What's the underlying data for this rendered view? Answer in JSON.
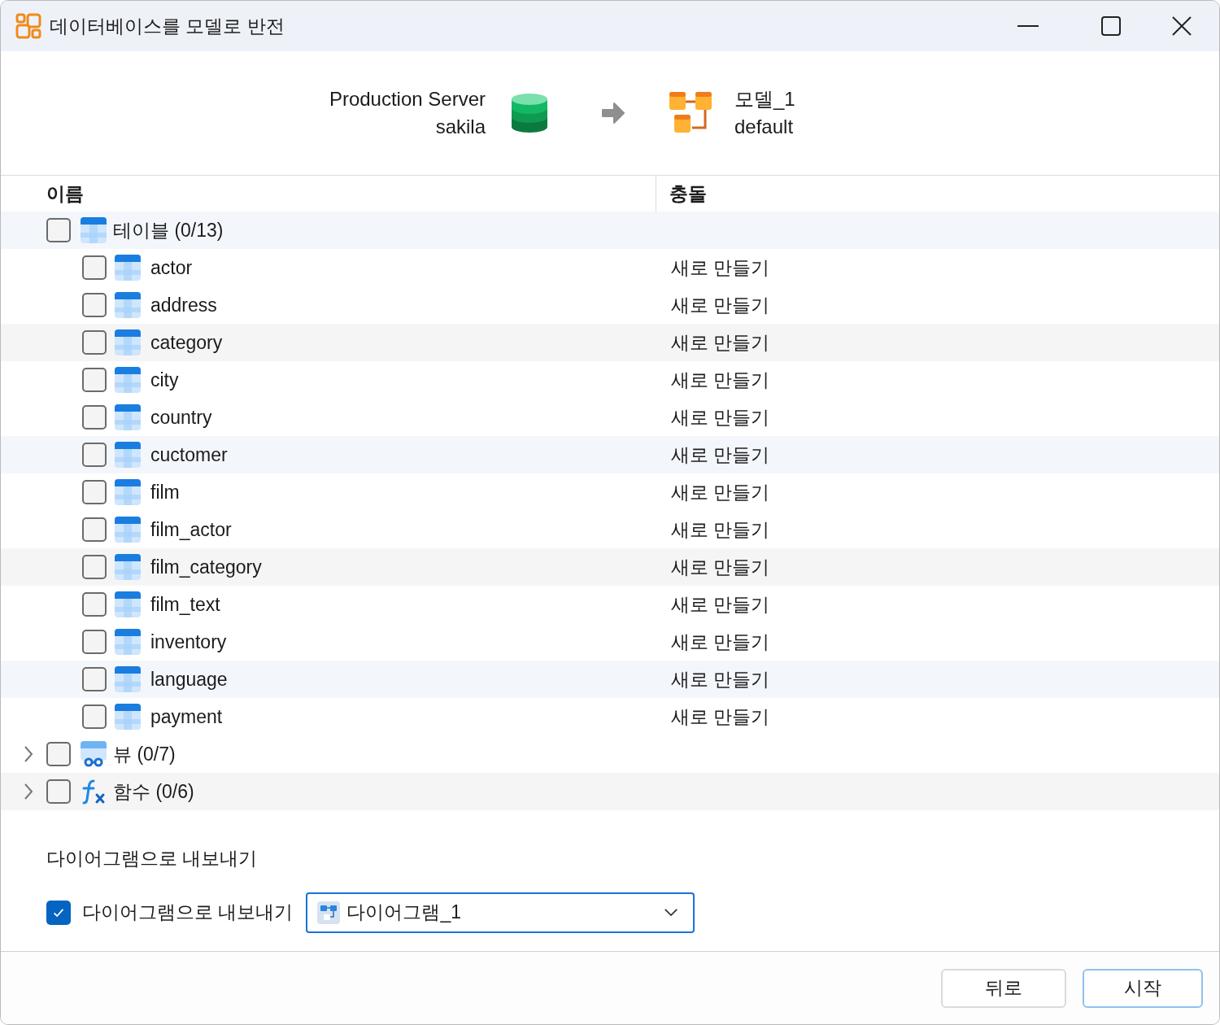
{
  "window": {
    "title": "데이터베이스를 모델로 반전"
  },
  "source": {
    "server": "Production Server",
    "database": "sakila"
  },
  "target": {
    "model": "모델_1",
    "schema": "default"
  },
  "columns": [
    "이름",
    "충돌"
  ],
  "tree": [
    {
      "kind": "table",
      "label": "테이블 (0/13)",
      "checked": false,
      "expanded": true,
      "children": [
        {
          "name": "actor",
          "checked": false,
          "conflict": "새로 만들기"
        },
        {
          "name": "address",
          "checked": false,
          "conflict": "새로 만들기"
        },
        {
          "name": "category",
          "checked": false,
          "conflict": "새로 만들기"
        },
        {
          "name": "city",
          "checked": false,
          "conflict": "새로 만들기"
        },
        {
          "name": "country",
          "checked": false,
          "conflict": "새로 만들기"
        },
        {
          "name": "cuctomer",
          "checked": false,
          "conflict": "새로 만들기"
        },
        {
          "name": "film",
          "checked": false,
          "conflict": "새로 만들기"
        },
        {
          "name": "film_actor",
          "checked": false,
          "conflict": "새로 만들기"
        },
        {
          "name": "film_category",
          "checked": false,
          "conflict": "새로 만들기"
        },
        {
          "name": "film_text",
          "checked": false,
          "conflict": "새로 만들기"
        },
        {
          "name": "inventory",
          "checked": false,
          "conflict": "새로 만들기"
        },
        {
          "name": "language",
          "checked": false,
          "conflict": "새로 만들기"
        },
        {
          "name": "payment",
          "checked": false,
          "conflict": "새로 만들기"
        }
      ]
    },
    {
      "kind": "view",
      "label": "뷰 (0/7)",
      "checked": false,
      "expanded": false
    },
    {
      "kind": "function",
      "label": "함수 (0/6)",
      "checked": false,
      "expanded": false
    }
  ],
  "export": {
    "heading": "다이어그램으로 내보내기",
    "label": "다이어그램으로 내보내기",
    "checked": true,
    "diagram": "다이어그램_1"
  },
  "buttons": [
    {
      "label": "뒤로",
      "kind": "secondary"
    },
    {
      "label": "시작",
      "kind": "primary"
    }
  ]
}
